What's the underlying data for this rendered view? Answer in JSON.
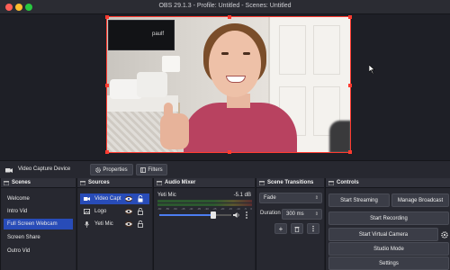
{
  "window": {
    "title": "OBS 29.1.3 - Profile: Untitled - Scenes: Untitled"
  },
  "preview": {
    "tv_logo_text": "paulf"
  },
  "source_toolbar": {
    "source_name": "Video Capture Device",
    "properties_label": "Properties",
    "filters_label": "Filters"
  },
  "scenes": {
    "title": "Scenes",
    "items": [
      "Welcome",
      "Intro Vid",
      "Full Screen Webcam",
      "Screen Share",
      "Outro Vid"
    ],
    "active_index": 2
  },
  "sources": {
    "title": "Sources",
    "items": [
      {
        "label": "Video Capt",
        "icon": "camera-icon",
        "active": true
      },
      {
        "label": "Logo",
        "icon": "image-icon",
        "active": false
      },
      {
        "label": "Yeti Mic",
        "icon": "microphone-icon",
        "active": false
      }
    ]
  },
  "mixer": {
    "title": "Audio Mixer",
    "channel_name": "Yeti Mic",
    "level_db": "-5.1 dB",
    "scale": [
      "-60",
      "-55",
      "-50",
      "-45",
      "-40",
      "-35",
      "-30",
      "-25",
      "-20",
      "-15",
      "-10",
      "-5",
      "0"
    ],
    "volume_fraction": 0.75
  },
  "transitions": {
    "title": "Scene Transitions",
    "selected": "Fade",
    "duration_label": "Duration",
    "duration_value": "300 ms"
  },
  "controls": {
    "title": "Controls",
    "start_streaming": "Start Streaming",
    "manage_broadcast": "Manage Broadcast",
    "start_recording": "Start Recording",
    "start_virtual_camera": "Start Virtual Camera",
    "studio_mode": "Studio Mode",
    "settings": "Settings"
  },
  "colors": {
    "selection_red": "#ff3b30",
    "active_blue": "#284cb8",
    "panel_bg": "#272830"
  }
}
